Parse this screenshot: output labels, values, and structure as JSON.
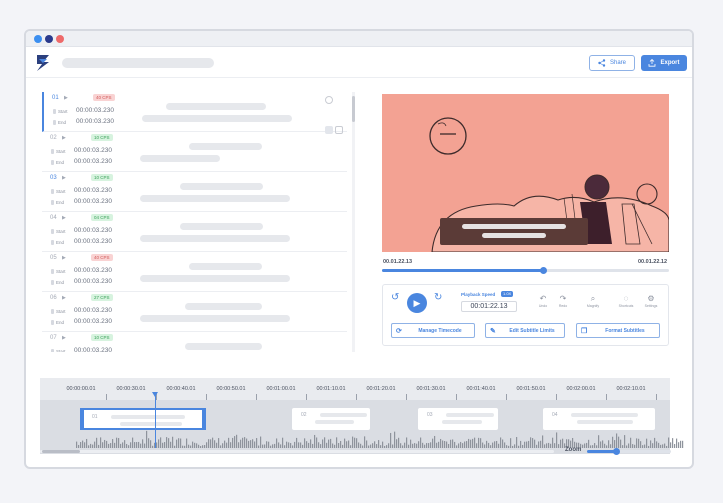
{
  "header": {
    "share_label": "Share",
    "export_label": "Export",
    "colors": {
      "accent": "#4a86df"
    }
  },
  "subtitles": [
    {
      "number": "01",
      "cps": "40 CPS",
      "cps_status": "red",
      "start_label": "Start",
      "end_label": "End",
      "start": "00:00:03.230",
      "end": "00:00:03.230",
      "active": true
    },
    {
      "number": "02",
      "cps": "10 CPS",
      "cps_status": "green",
      "start_label": "Start",
      "end_label": "End",
      "start": "00:00:03.230",
      "end": "00:00:03.230"
    },
    {
      "number": "03",
      "cps": "10 CPS",
      "cps_status": "green",
      "start_label": "Start",
      "end_label": "End",
      "start": "00:00:03.230",
      "end": "00:00:03.230"
    },
    {
      "number": "04",
      "cps": "04 CPS",
      "cps_status": "green",
      "start_label": "Start",
      "end_label": "End",
      "start": "00:00:03.230",
      "end": "00:00:03.230"
    },
    {
      "number": "05",
      "cps": "40 CPS",
      "cps_status": "red",
      "start_label": "Start",
      "end_label": "End",
      "start": "00:00:03.230",
      "end": "00:00:03.230"
    },
    {
      "number": "06",
      "cps": "27 CPS",
      "cps_status": "green",
      "start_label": "Start",
      "end_label": "End",
      "start": "00:00:03.230",
      "end": "00:00:03.230"
    },
    {
      "number": "07",
      "cps": "10 CPS",
      "cps_status": "green",
      "start_label": "Start",
      "end_label": "End",
      "start": "00:00:03.230",
      "end": "00:00:03.230"
    }
  ],
  "player": {
    "current_time": "00.01.22.13",
    "total_time": "00.01.22.12",
    "progress": 0.56,
    "playback_speed_label": "Playback Speed",
    "playback_speed_value": "1.0X",
    "timecode": "00:01:22.13",
    "tools": [
      {
        "icon": "undo-icon",
        "label": "Undo"
      },
      {
        "icon": "redo-icon",
        "label": "Redo"
      },
      {
        "icon": "magnify-icon",
        "label": "Magnify"
      },
      {
        "icon": "shortcuts-icon",
        "label": "Shortcuts"
      },
      {
        "icon": "settings-icon",
        "label": "Settings"
      }
    ],
    "actions": {
      "manage_timecode": "Manage Timecode",
      "edit_subtitle_limits": "Edit Subtitle Limits",
      "format_subtitles": "Format Subtitles"
    }
  },
  "timeline": {
    "ticks": [
      "00:00:00.01",
      "00:00:30.01",
      "00:00:40.01",
      "00:00:50.01",
      "00:01:00.01",
      "00:01:10.01",
      "00:01:20.01",
      "00:01:30.01",
      "00:01:40.01",
      "00:01:50.01",
      "00:02:00.01",
      "00:02:10.01"
    ],
    "segments": [
      {
        "number": "01",
        "selected": true
      },
      {
        "number": "02"
      },
      {
        "number": "03"
      },
      {
        "number": "04"
      }
    ],
    "zoom_label": "Zoom",
    "zoom_level": 0.35
  }
}
